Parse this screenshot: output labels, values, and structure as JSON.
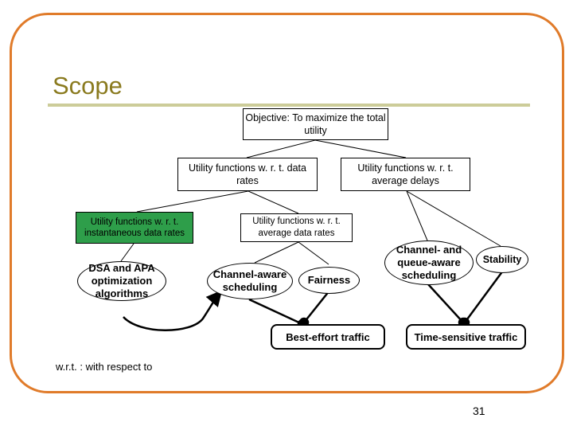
{
  "slide": {
    "title": "Scope",
    "page_number": "31",
    "footnote": "w.r.t. : with respect to"
  },
  "diagram": {
    "objective": "Objective: To maximize the total utility",
    "util_data_rates": "Utility functions w. r. t. data rates",
    "util_avg_delays": "Utility functions w. r. t. average delays",
    "util_instantaneous": "Utility functions w. r. t. instantaneous data rates",
    "util_avg_data_rates": "Utility functions w. r. t. average data rates",
    "dsa_apa": "DSA and APA optimization algorithms",
    "channel_aware": "Channel-aware scheduling",
    "fairness": "Fairness",
    "channel_queue_aware": "Channel- and queue-aware scheduling",
    "stability": "Stability",
    "best_effort": "Best-effort traffic",
    "time_sensitive": "Time-sensitive traffic"
  },
  "colors": {
    "frame": "#e07b2a",
    "title": "#8a7a1e",
    "rule": "#cccc99",
    "green": "#2e9e4a"
  }
}
